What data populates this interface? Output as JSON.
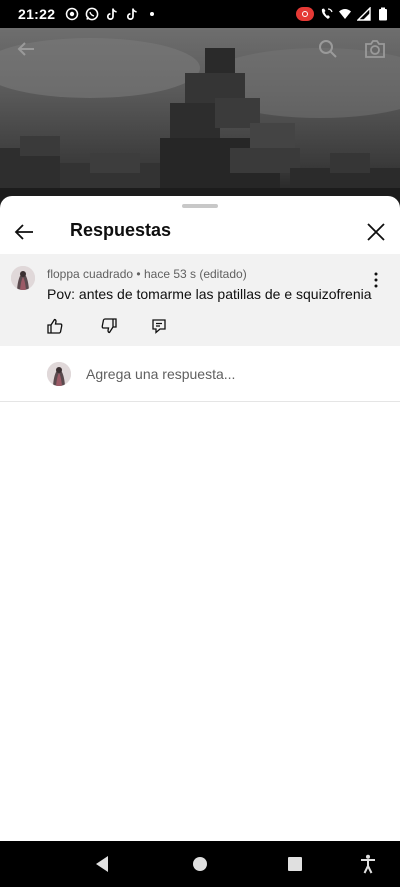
{
  "status_bar": {
    "time": "21:22",
    "left_icons": [
      "screen-record-icon",
      "whatsapp-icon",
      "tiktok-icon",
      "tiktok-icon",
      "dot-icon"
    ],
    "right_icons": [
      "recording-badge-icon",
      "wifi-call-icon",
      "wifi-icon",
      "signal-icon",
      "battery-icon"
    ]
  },
  "video": {
    "back_icon": "arrow-left-icon",
    "search_icon": "search-icon",
    "camera_icon": "camera-icon"
  },
  "sheet": {
    "title": "Respuestas",
    "back_icon": "arrow-left-icon",
    "close_icon": "close-icon"
  },
  "comment": {
    "author": "floppa cuadrado",
    "meta_separator": "•",
    "time": "hace 53 s (editado)",
    "text": "Pov: antes de tomarme las patillas de e squizofrenia",
    "actions": [
      "like-icon",
      "dislike-icon",
      "reply-icon"
    ]
  },
  "reply": {
    "placeholder": "Agrega una respuesta..."
  },
  "nav_bar": {
    "buttons": [
      "back-triangle-icon",
      "home-circle-icon",
      "recents-square-icon",
      "accessibility-icon"
    ]
  },
  "colors": {
    "sheet_bg": "#ffffff",
    "comment_bg": "#f2f2f2",
    "text_primary": "#0f0f0f",
    "text_secondary": "#606060",
    "status_bar_bg": "#000000",
    "record_badge": "#e53935"
  }
}
